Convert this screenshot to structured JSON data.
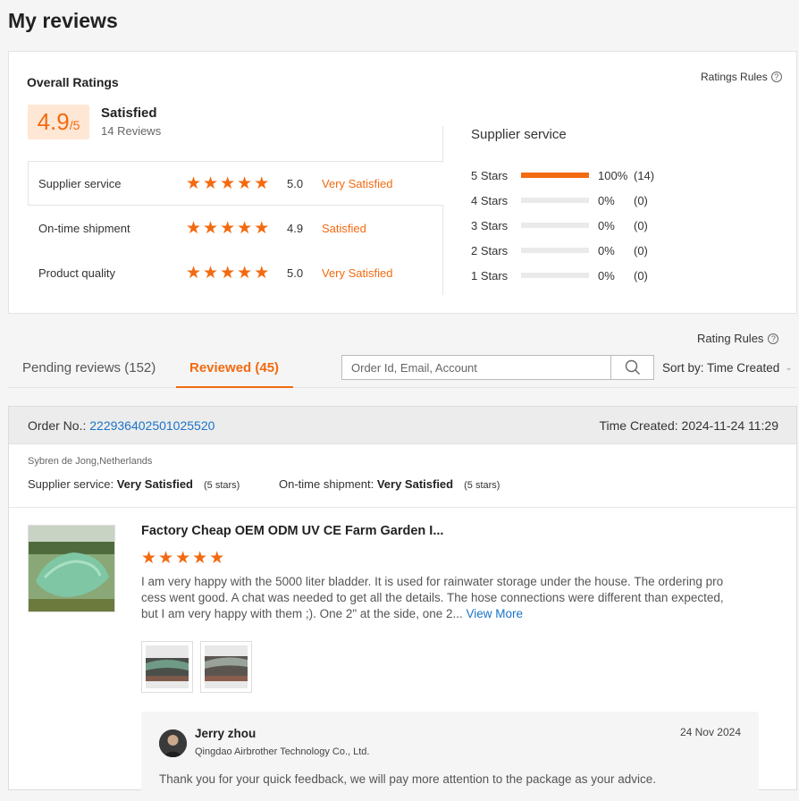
{
  "page": {
    "title": "My reviews"
  },
  "overall": {
    "title": "Overall Ratings",
    "rules_label": "Ratings Rules",
    "score": "4.9",
    "score_suffix": "/5",
    "satisfaction": "Satisfied",
    "reviews_count": "14 Reviews",
    "rows": [
      {
        "label": "Supplier service",
        "stars": 5,
        "value": "5.0",
        "text": "Very Satisfied"
      },
      {
        "label": "On-time shipment",
        "stars": 5,
        "value": "4.9",
        "text": "Satisfied"
      },
      {
        "label": "Product quality",
        "stars": 5,
        "value": "5.0",
        "text": "Very Satisfied"
      }
    ]
  },
  "breakdown": {
    "title": "Supplier service",
    "rows": [
      {
        "label": "5  Stars",
        "fraction": 1.0,
        "pct": "100%",
        "count": "(14)"
      },
      {
        "label": "4  Stars",
        "fraction": 0,
        "pct": "0%",
        "count": "(0)"
      },
      {
        "label": "3  Stars",
        "fraction": 0,
        "pct": "0%",
        "count": "(0)"
      },
      {
        "label": "2  Stars",
        "fraction": 0,
        "pct": "0%",
        "count": "(0)"
      },
      {
        "label": "1  Stars",
        "fraction": 0,
        "pct": "0%",
        "count": "(0)"
      }
    ]
  },
  "toolbar": {
    "rules_label": "Rating Rules",
    "tab_pending": "Pending reviews (152)",
    "tab_reviewed": "Reviewed (45)",
    "search_placeholder": "Order Id, Email, Account",
    "sort_label": "Sort by: Time Created"
  },
  "order": {
    "order_no_label": "Order No.: ",
    "order_no": "222936402501025520",
    "time_created": "Time Created: 2024-11-24 11:29",
    "buyer": "Sybren de Jong,Netherlands",
    "supplier_service_label": "Supplier service: ",
    "supplier_service_value": "Very Satisfied",
    "supplier_service_stars": "(5 stars)",
    "shipment_label": "On-time shipment: ",
    "shipment_value": "Very Satisfied",
    "shipment_stars": "(5 stars)",
    "product_title": "Factory Cheap OEM ODM UV CE Farm Garden I...",
    "product_stars": 5,
    "review_text": "I am very happy with the 5000 liter bladder. It is used for rainwater storage under the house. The ordering process went good. A chat was needed to get all the details. The hose connections were different than expected, but I am very happy with them ;). One 2\" at the side, one 2...",
    "view_more": "View More",
    "reply": {
      "name": "Jerry zhou",
      "company": "Qingdao Airbrother Technology Co., Ltd.",
      "date": "24 Nov 2024",
      "text": "Thank you for your quick feedback, we will pay more attention to the package as your advice."
    }
  },
  "colors": {
    "accent": "#f36a10",
    "link": "#1a73c9"
  },
  "icons": [
    "question-icon",
    "search-icon",
    "chevron-down-icon",
    "star-icon"
  ]
}
